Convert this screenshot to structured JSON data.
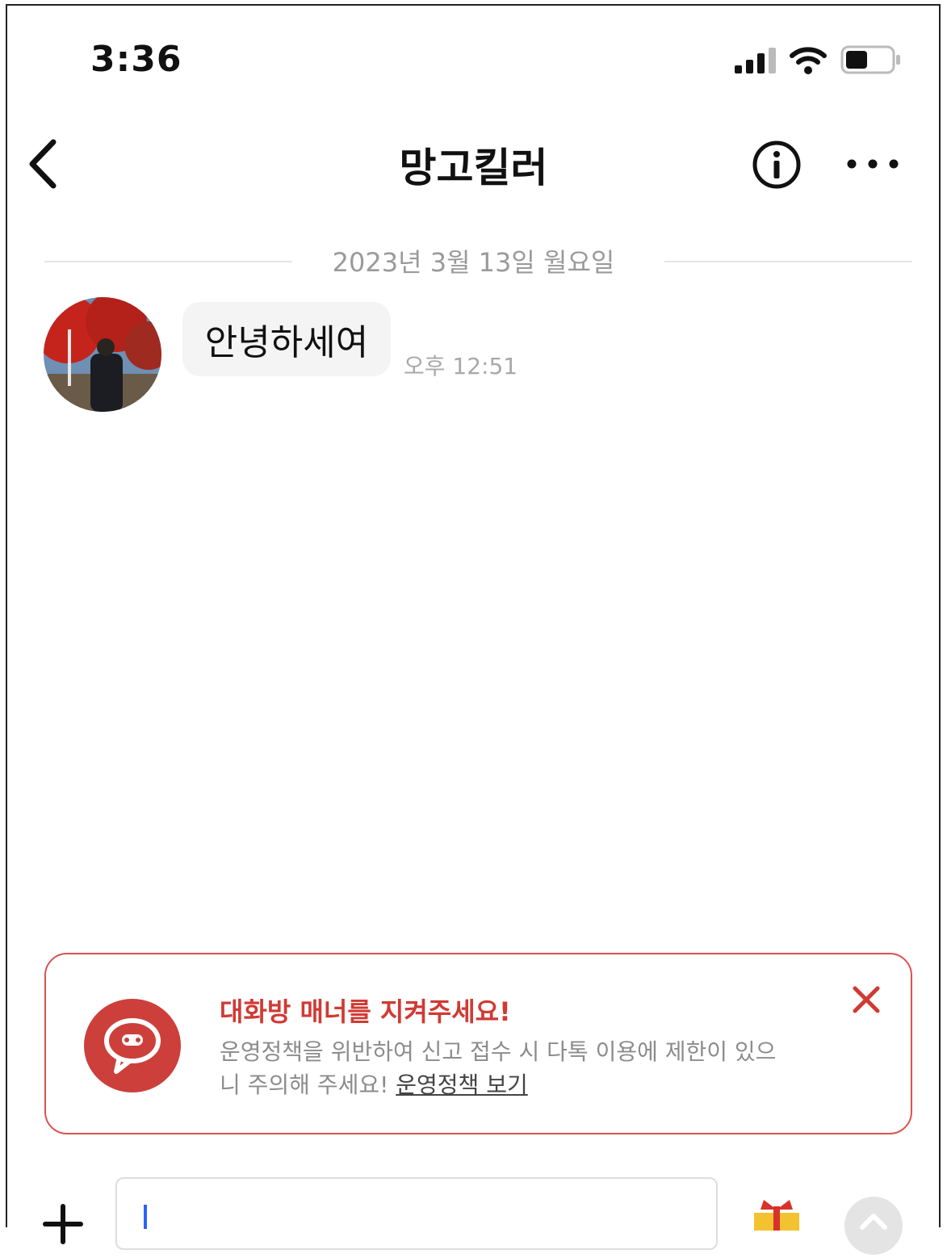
{
  "status_bar": {
    "time": "3:36"
  },
  "header": {
    "title": "망고킬러"
  },
  "chat": {
    "date_divider": "2023년 3월 13일 월요일",
    "messages": [
      {
        "text": "안녕하세여",
        "time": "오후 12:51"
      }
    ]
  },
  "notice": {
    "title": "대화방 매너를 지켜주세요!",
    "body_line1": "운영정책을 위반하여 신고 접수 시 다톡 이용에 제한이 있으",
    "body_line2": "니 주의해 주세요!",
    "link": "운영정책 보기"
  },
  "colors": {
    "accent_red": "#cc3f3a",
    "caret_blue": "#2a62ff"
  },
  "icons": [
    "back-icon",
    "info-icon",
    "more-icon",
    "close-icon",
    "chat-bubble-icon",
    "plus-icon",
    "gift-icon",
    "send-icon",
    "signal-icon",
    "wifi-icon",
    "battery-icon"
  ]
}
